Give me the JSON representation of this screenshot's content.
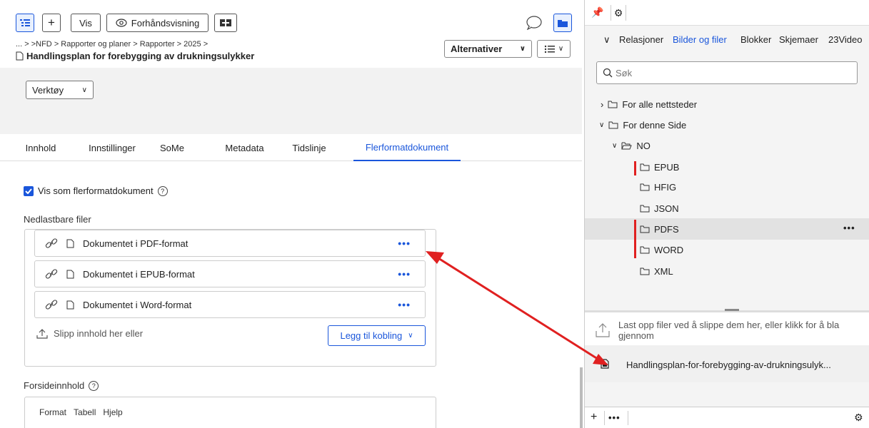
{
  "toolbar": {
    "view_label": "Vis",
    "preview_label": "Forhåndsvisning",
    "plus_label": "+"
  },
  "breadcrumb": [
    "...",
    ">NFD",
    "Rapporter og planer",
    "Rapporter",
    "2025"
  ],
  "page_title": "Handlingsplan for forebygging av drukningsulykker",
  "options_label": "Alternativer",
  "tools_label": "Verktøy",
  "tabs": [
    "Innhold",
    "Innstillinger",
    "SoMe",
    "Metadata",
    "Tidslinje",
    "Flerformatdokument"
  ],
  "active_tab": "Flerformatdokument",
  "checkbox": {
    "label": "Vis som flerformatdokument",
    "checked": true
  },
  "downloads": {
    "label": "Nedlastbare filer",
    "files": [
      "Dokumentet i PDF-format",
      "Dokumentet i EPUB-format",
      "Dokumentet i Word-format"
    ],
    "drop_hint": "Slipp innhold her eller",
    "add_link": "Legg til kobling"
  },
  "front_content": {
    "label": "Forsideinnhold",
    "menu": [
      "Format",
      "Tabell",
      "Hjelp"
    ]
  },
  "right_panel": {
    "tabs": [
      "Relasjoner",
      "Bilder og filer",
      "Blokker",
      "Skjemaer",
      "23Video"
    ],
    "active_tab": "Bilder og filer",
    "search_placeholder": "Søk",
    "tree": {
      "all_sites": "For alle nettsteder",
      "this_page": "For denne Side",
      "no": "NO",
      "folders": [
        "EPUB",
        "HFIG",
        "JSON",
        "PDFS",
        "WORD",
        "XML"
      ],
      "selected": "PDFS"
    },
    "upload_text": "Last opp filer ved å slippe dem her, eller klikk for å bla gjennom",
    "file_name": "Handlingsplan-for-forebygging-av-drukningsulyk..."
  },
  "colors": {
    "accent": "#1a56db",
    "annotation_red": "#e02020",
    "toolbar_bg": "#f2f2f2",
    "selected_row": "#e2e2e2"
  }
}
